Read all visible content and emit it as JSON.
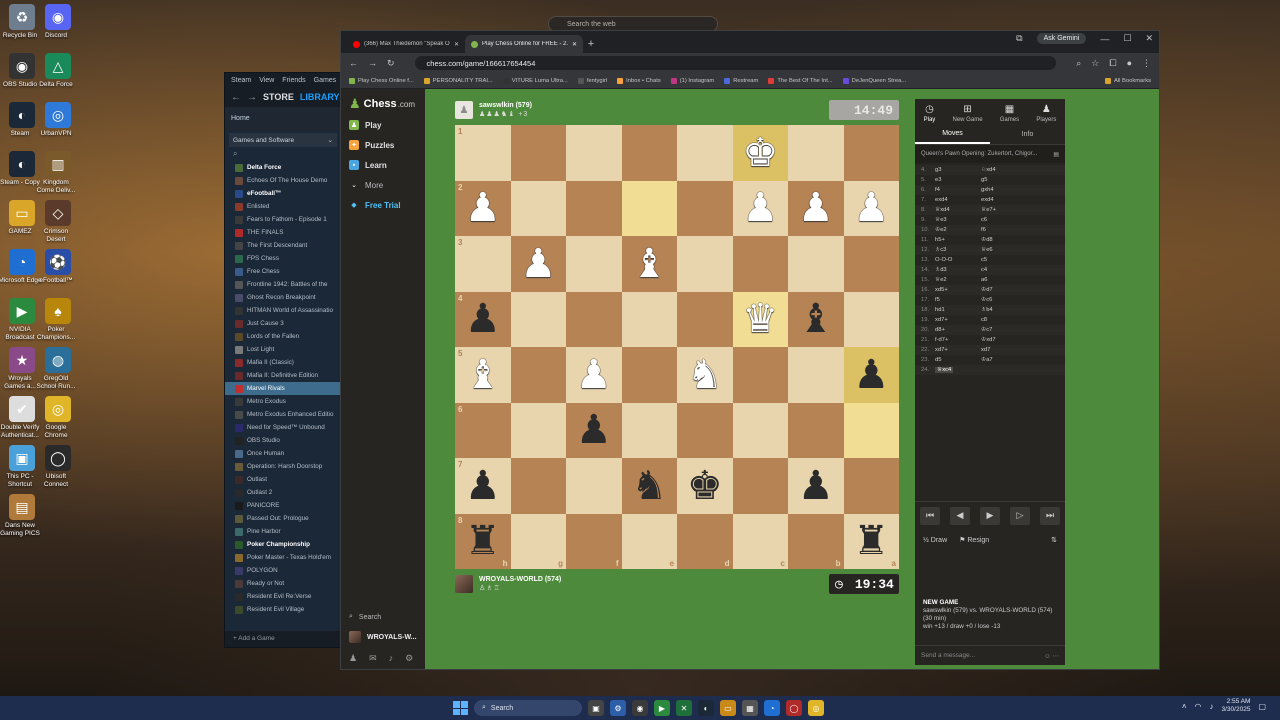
{
  "desktop": {
    "icons": [
      "Recycle Bin",
      "Discord",
      "OBS Studio",
      "Delta Force",
      "Steam",
      "UrbanVPN",
      "Steam - Copy",
      "Kingdom Come Deliv...",
      "GAMEZ",
      "Crimson Desert",
      "Microsoft Edge",
      "eFootball™",
      "NVIDIA Broadcast",
      "Poker Champions...",
      "Wroyals Games a...",
      "GregOld School Run...",
      "Double Verify Authenticat...",
      "Google Chrome",
      "This PC - Shortcut",
      "Ubisoft Connect",
      "Dans New Gaming PICS"
    ],
    "floating_search": "Search the web"
  },
  "steam": {
    "menu": [
      "Steam",
      "View",
      "Friends",
      "Games",
      "Help"
    ],
    "nav_store": "STORE",
    "nav_library": "LIBRARY",
    "home": "Home",
    "filter": "Games and Software",
    "games": [
      "Delta Force",
      "Echoes Of The House Demo",
      "eFootball™",
      "Enlisted",
      "Fears to Fathom - Episode 1",
      "THE FINALS",
      "The First Descendant",
      "FPS Chess",
      "Free Chess",
      "Frontline 1942: Battles of the",
      "Ghost Recon Breakpoint",
      "HITMAN World of Assassinatio",
      "Just Cause 3",
      "Lords of the Fallen",
      "Lost Light",
      "Mafia II (Classic)",
      "Mafia II: Definitive Edition",
      "Marvel Rivals",
      "Metro Exodus",
      "Metro Exodus Enhanced Editio",
      "Need for Speed™ Unbound",
      "OBS Studio",
      "Once Human",
      "Operation: Harsh Doorstop",
      "Outlast",
      "Outlast 2",
      "PANICORE",
      "Passed Out: Prologue",
      "Pine Harbor",
      "Poker Championship",
      "Poker Master - Texas Hold'em",
      "POLYGON",
      "Ready or Not",
      "Resident Evil Re:Verse",
      "Resident Evil Village"
    ],
    "add_game": "Add a Game"
  },
  "browser": {
    "tabs": [
      "(366) Max Thiedemon \"Speak O...",
      "Play Chess Online for FREE - 2..."
    ],
    "ask_gemini": "Ask Gemini",
    "url": "chess.com/game/166617654454",
    "bookmarks": [
      "Play Chess Online f...",
      "PERSONALITY TRAI...",
      "VITURE Luma Ultra...",
      "fentygirl",
      "Inbox • Chats",
      "(1) Instagram",
      "Restream",
      "The Best Of The Int...",
      "DeJenQueen Strea...",
      "All Bookmarks"
    ]
  },
  "chesscom": {
    "logo": "Chess",
    "logo_suffix": ".com",
    "nav": [
      "Play",
      "Puzzles",
      "Learn",
      "More",
      "Free Trial"
    ],
    "search": "Search",
    "user": "WROYALS-W...",
    "top_player": {
      "name": "sawswlkin (579)",
      "captured": "♟♟♟♞♝ +3",
      "clock": "14:49"
    },
    "bottom_player": {
      "name": "WROYALS-WORLD (574)",
      "captured": "♙♗♖",
      "clock": "19:34"
    },
    "board": {
      "ranks": [
        "1",
        "2",
        "3",
        "4",
        "5",
        "6",
        "7",
        "8"
      ],
      "files": [
        "h",
        "g",
        "f",
        "e",
        "d",
        "c",
        "b",
        "a"
      ],
      "rows": [
        [
          "",
          "",
          "",
          "",
          "",
          "wK",
          "",
          ""
        ],
        [
          "wP",
          "",
          "",
          "",
          "",
          "wP",
          "wP",
          "wP"
        ],
        [
          "",
          "wP",
          "",
          "wB",
          "",
          "",
          "",
          ""
        ],
        [
          "bP",
          "",
          "",
          "",
          "",
          "wQ",
          "bB",
          ""
        ],
        [
          "wB",
          "",
          "wP",
          "",
          "wN",
          "",
          "",
          "bP"
        ],
        [
          "",
          "",
          "bP",
          "",
          "",
          "",
          "",
          ""
        ],
        [
          "bP",
          "",
          "",
          "bN",
          "bK",
          "",
          "bP",
          ""
        ],
        [
          "bR",
          "",
          "",
          "",
          "",
          "",
          "",
          "bR"
        ]
      ],
      "highlights": [
        [
          0,
          5
        ],
        [
          3,
          5
        ],
        [
          4,
          7
        ],
        [
          5,
          7
        ],
        [
          1,
          3
        ]
      ]
    },
    "panel": {
      "top_tabs": [
        "Play",
        "New Game",
        "Games",
        "Players"
      ],
      "tabs": [
        "Moves",
        "Info"
      ],
      "opening": "Queen's Pawn Opening: Zukertort, Chigor...",
      "moves": [
        [
          "4.",
          "g3",
          "♘xd4"
        ],
        [
          "5.",
          "e3",
          "g5"
        ],
        [
          "6.",
          "f4",
          "gxh4"
        ],
        [
          "7.",
          "exd4",
          "exd4"
        ],
        [
          "8.",
          "♕xd4",
          "♕e7+"
        ],
        [
          "9.",
          "♕e3",
          "c6"
        ],
        [
          "10.",
          "♔e2",
          "f6"
        ],
        [
          "11.",
          "h5+",
          "♔d8"
        ],
        [
          "12.",
          "♗c3",
          "♕e6"
        ],
        [
          "13.",
          "O-O-O",
          "c5"
        ],
        [
          "14.",
          "♗d3",
          "c4"
        ],
        [
          "15.",
          "♕e2",
          "a6"
        ],
        [
          "16.",
          "xd5+",
          "♔d7"
        ],
        [
          "17.",
          "f5",
          "♔c6"
        ],
        [
          "18.",
          "hd1",
          "♗b4"
        ],
        [
          "19.",
          "xd7+",
          "c8"
        ],
        [
          "20.",
          "d8+",
          "♔c7"
        ],
        [
          "21.",
          "f-d7+",
          "♔xd7"
        ],
        [
          "22.",
          "xd7+",
          "xd7"
        ],
        [
          "23.",
          "d5",
          "♔a7"
        ],
        [
          "24.",
          "♕xc4",
          ""
        ]
      ],
      "controls": [
        "⏮",
        "◀",
        "▶",
        "▷",
        "⏭"
      ],
      "draw": "Draw",
      "resign": "Resign",
      "new_game_title": "NEW GAME",
      "new_game_line1": "sawswlkin (579) vs. WROYALS-WORLD (574)",
      "new_game_line2": "(30 min)",
      "new_game_line3": "win +13 / draw +0 / lose -13",
      "chat_placeholder": "Send a message..."
    }
  },
  "taskbar": {
    "search": "Search",
    "time": "2:55 AM",
    "date": "3/30/2025"
  }
}
